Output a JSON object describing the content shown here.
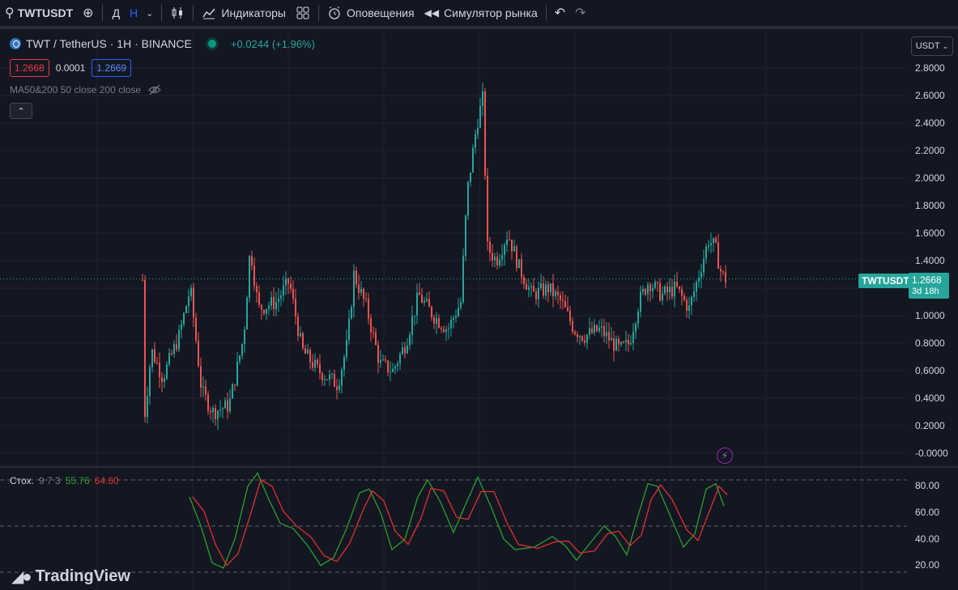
{
  "toolbar": {
    "symbol": "TWTUSDT",
    "interval_d": "Д",
    "interval_h": "Н",
    "indicators_label": "Индикаторы",
    "alerts_label": "Оповещения",
    "replay_label": "Симулятор рынка"
  },
  "legend": {
    "title": "TWT / TetherUS · 1H · BINANCE",
    "change": "+0.0244 (+1.96%)",
    "sell_price": "1.2668",
    "spread": "0.0001",
    "buy_price": "1.2669",
    "ma_label": "MA50&200 50 close 200 close"
  },
  "price_axis": {
    "currency": "USDT",
    "labels": [
      "2.8000",
      "2.6000",
      "2.4000",
      "2.2000",
      "2.0000",
      "1.8000",
      "1.6000",
      "1.4000",
      "1.2000",
      "1.0000",
      "0.8000",
      "0.6000",
      "0.4000",
      "0.2000",
      "-0.0000"
    ],
    "current_price": "1.2668",
    "countdown": "3d 18h",
    "symbol_tag": "TWTUSDT"
  },
  "stoch": {
    "label": "Стох.",
    "params": "9 7 3",
    "k_value": "55.76",
    "d_value": "64.60",
    "axis_labels": [
      "80.00",
      "60.00",
      "40.00",
      "20.00"
    ]
  },
  "colors": {
    "up": "#26a69a",
    "down": "#ef5350",
    "k_line": "#2e9e2e",
    "d_line": "#e03030"
  },
  "branding": {
    "logo_text": "TradingView"
  }
}
